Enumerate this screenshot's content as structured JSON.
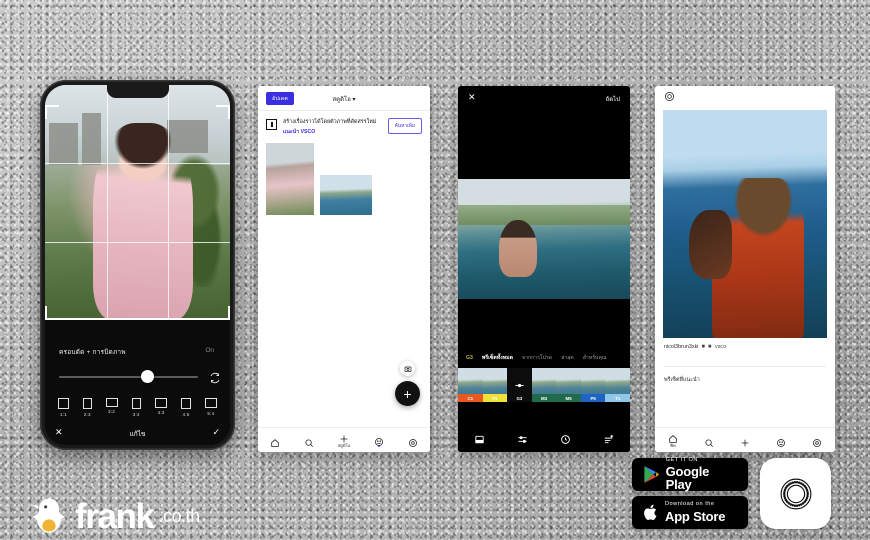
{
  "background": {
    "color": "#b9b9b9",
    "texture": "concrete-asphalt"
  },
  "phone1": {
    "name": "vsco-crop-editor",
    "tool_label": "ครอบตัด + การบิดภาพ",
    "tool_value": "On",
    "slider_percent": 48,
    "rotate_icon": "rotate-icon",
    "aspect_ratios": [
      {
        "label": "1:1",
        "w": 9,
        "h": 9
      },
      {
        "label": "2:3",
        "w": 6.5,
        "h": 9
      },
      {
        "label": "3:2",
        "w": 10,
        "h": 6.5
      },
      {
        "label": "3:4",
        "w": 7.5,
        "h": 9
      },
      {
        "label": "4:3",
        "w": 10,
        "h": 7.5
      },
      {
        "label": "4:5",
        "w": 7.8,
        "h": 9
      },
      {
        "label": "5:4",
        "w": 10,
        "h": 8
      }
    ],
    "cancel_icon": "close-icon",
    "bottom_title": "แก้ไข",
    "confirm_icon": "check-icon"
  },
  "phone2": {
    "name": "vsco-discover-feed",
    "pill_label": "อัปเดต",
    "header_title": "สตูดิโอ",
    "header_chevron": "chevron-down-icon",
    "card": {
      "icon": "book-icon",
      "line1": "สร้างเรื่องราวได้โดยตัวภาพที่คัดสรรใหม่",
      "line2": "แนะนำ VSCO",
      "button": "ค้นหาเพิ่ม"
    },
    "camera_icon": "camera-icon",
    "plus_fab": "+",
    "nav": [
      {
        "icon": "home-icon",
        "label": ""
      },
      {
        "icon": "search-icon",
        "label": ""
      },
      {
        "icon": "plus-icon",
        "label": "สตูดิโอ"
      },
      {
        "icon": "smiley-icon",
        "label": ""
      },
      {
        "icon": "gear-icon",
        "label": ""
      }
    ]
  },
  "phone3": {
    "name": "vsco-filter-editor",
    "close_icon": "close-icon",
    "next_label": "ถัดไป",
    "tabs": [
      {
        "label": "G3",
        "type": "badge"
      },
      {
        "label": "พรีเซ็ตทั้งหมด",
        "type": "active"
      },
      {
        "label": "จากการโปรด",
        "type": "normal"
      },
      {
        "label": "ล่าสุด",
        "type": "normal"
      },
      {
        "label": "สำหรับคุณ",
        "type": "normal"
      }
    ],
    "presets": [
      {
        "label": "C1",
        "color": "#e8581f"
      },
      {
        "label": "F2",
        "color": "#efe03c"
      },
      {
        "label": "G3",
        "color": "#111111",
        "is_control": true
      },
      {
        "label": "M3",
        "color": "#1f6b4a"
      },
      {
        "label": "M5",
        "color": "#1f6b4a"
      },
      {
        "label": "P5",
        "color": "#1f63c4"
      },
      {
        "label": "T1",
        "color": "#8fc7e8"
      }
    ],
    "tools": [
      "presets-icon",
      "adjust-icon",
      "undo-icon",
      "text-icon"
    ]
  },
  "phone4": {
    "name": "vsco-post-view",
    "logo_icon": "vsco-logo-icon",
    "caption_user": "nicol3brun3ski",
    "caption_tag": "vsco",
    "suggest_label": "พรีเซ็ตที่แนะนำ",
    "nav": [
      {
        "icon": "home-icon",
        "label": "ฟีด"
      },
      {
        "icon": "search-icon",
        "label": ""
      },
      {
        "icon": "plus-icon",
        "label": ""
      },
      {
        "icon": "smiley-icon",
        "label": ""
      },
      {
        "icon": "gear-icon",
        "label": ""
      }
    ]
  },
  "store_badges": {
    "google_play": {
      "small": "GET IT ON",
      "big": "Google Play",
      "icon": "google-play-icon"
    },
    "app_store": {
      "small": "Download on the",
      "big": "App Store",
      "icon": "apple-icon"
    }
  },
  "app_icon": {
    "name": "vsco-app-icon"
  },
  "brand": {
    "name": "frank",
    "tld": ".co.th",
    "logo_icon": "penguin-logo-icon",
    "accent": "#f2b233"
  }
}
